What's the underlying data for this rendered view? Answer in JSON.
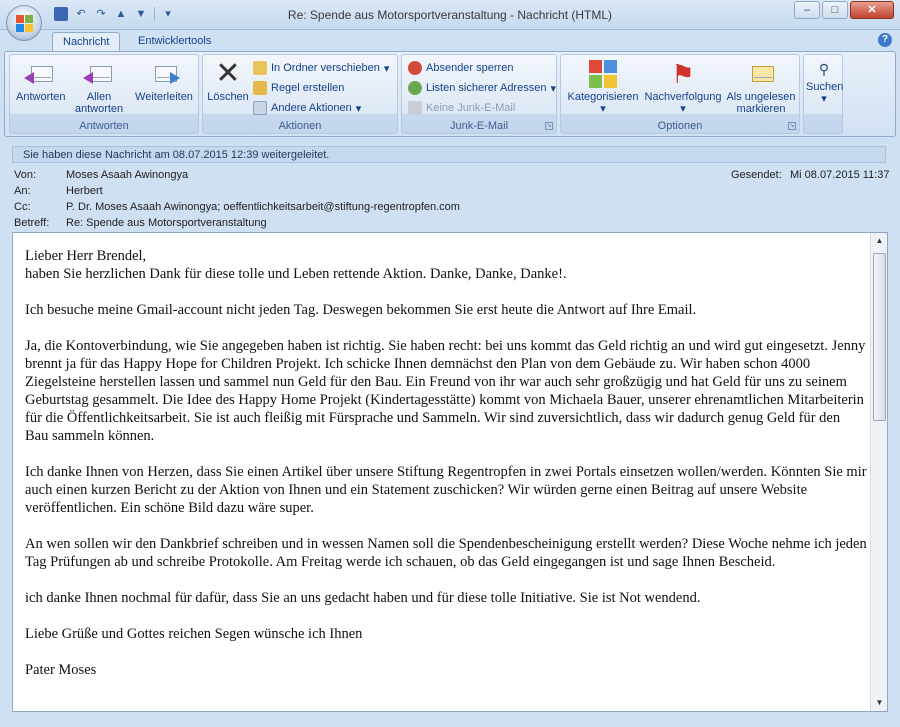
{
  "window": {
    "title": "Re: Spende aus Motorsportveranstaltung - Nachricht (HTML)",
    "buttons": {
      "minimize": "–",
      "maximize": "□",
      "close": "✕"
    }
  },
  "ribbon_tabs": [
    {
      "label": "Nachricht",
      "active": true
    },
    {
      "label": "Entwicklertools",
      "active": false
    }
  ],
  "ribbon": {
    "groups": {
      "antworten": {
        "label": "Antworten",
        "buttons": [
          "Antworten",
          "Allen antworten",
          "Weiterleiten"
        ]
      },
      "aktionen": {
        "label": "Aktionen",
        "loeschen": "Löschen",
        "in_ordner": "In Ordner verschieben",
        "regel": "Regel erstellen",
        "andere": "Andere Aktionen"
      },
      "junk": {
        "label": "Junk-E-Mail",
        "sperren": "Absender sperren",
        "listen": "Listen sicherer Adressen",
        "kein_junk": "Keine Junk-E-Mail"
      },
      "optionen": {
        "label": "Optionen",
        "kategorisieren": "Kategorisieren",
        "nachverfolgung": "Nachverfolgung",
        "ungelesen": "Als ungelesen markieren"
      },
      "suchen": {
        "label": "Suchen"
      }
    }
  },
  "info_bar": "Sie haben diese Nachricht am 08.07.2015 12:39 weitergeleitet.",
  "headers": {
    "von_label": "Von:",
    "von": "Moses Asaah Awinongya",
    "an_label": "An:",
    "an": "Herbert",
    "cc_label": "Cc:",
    "cc": "P. Dr. Moses Asaah Awinongya; oeffentlichkeitsarbeit@stiftung-regentropfen.com",
    "betreff_label": "Betreff:",
    "betreff": "Re: Spende aus Motorsportveranstaltung",
    "gesendet_label": "Gesendet:",
    "gesendet": "Mi 08.07.2015 11:37"
  },
  "body": {
    "p1": "Lieber Herr Brendel,\nhaben Sie herzlichen Dank für diese tolle und Leben rettende Aktion. Danke, Danke, Danke!.",
    "p2": "Ich besuche meine Gmail-account nicht jeden Tag. Deswegen bekommen Sie erst heute die Antwort auf Ihre Email.",
    "p3": "Ja, die Kontoverbindung, wie Sie angegeben haben ist richtig. Sie haben recht: bei uns kommt das Geld richtig an und wird gut eingesetzt. Jenny brennt ja für das Happy Hope for Children Projekt. Ich schicke Ihnen demnächst den Plan von dem Gebäude zu. Wir haben schon 4000 Ziegelsteine herstellen lassen und sammel nun Geld für den Bau. Ein Freund von ihr war auch sehr großzügig und hat Geld für uns zu seinem Geburtstag gesammelt. Die Idee des Happy Home Projekt (Kindertagesstätte) kommt von Michaela Bauer, unserer ehrenamtlichen Mitarbeiterin für die Öffentlichkeitsarbeit. Sie ist auch fleißig mit Fürsprache und Sammeln. Wir sind zuversichtlich, dass wir dadurch genug Geld für den Bau sammeln können.",
    "p4": "Ich danke Ihnen von Herzen, dass Sie einen Artikel über unsere Stiftung Regentropfen in zwei Portals einsetzen wollen/werden. Könnten Sie mir auch einen kurzen Bericht zu der Aktion von Ihnen und ein Statement zuschicken? Wir würden gerne einen Beitrag auf unsere Website veröffentlichen. Ein schöne Bild dazu wäre super.",
    "p5": "An wen sollen wir den Dankbrief schreiben und in wessen Namen soll die Spendenbescheinigung erstellt werden? Diese Woche nehme ich jeden Tag Prüfungen ab und schreibe Protokolle. Am Freitag werde  ich schauen, ob das Geld eingegangen ist und sage Ihnen Bescheid.",
    "p6": "ich danke Ihnen nochmal für dafür, dass Sie an uns gedacht haben und für diese tolle Initiative. Sie ist Not wendend.",
    "p7": "Liebe Grüße und Gottes reichen Segen wünsche ich Ihnen",
    "p8": "Pater Moses"
  }
}
